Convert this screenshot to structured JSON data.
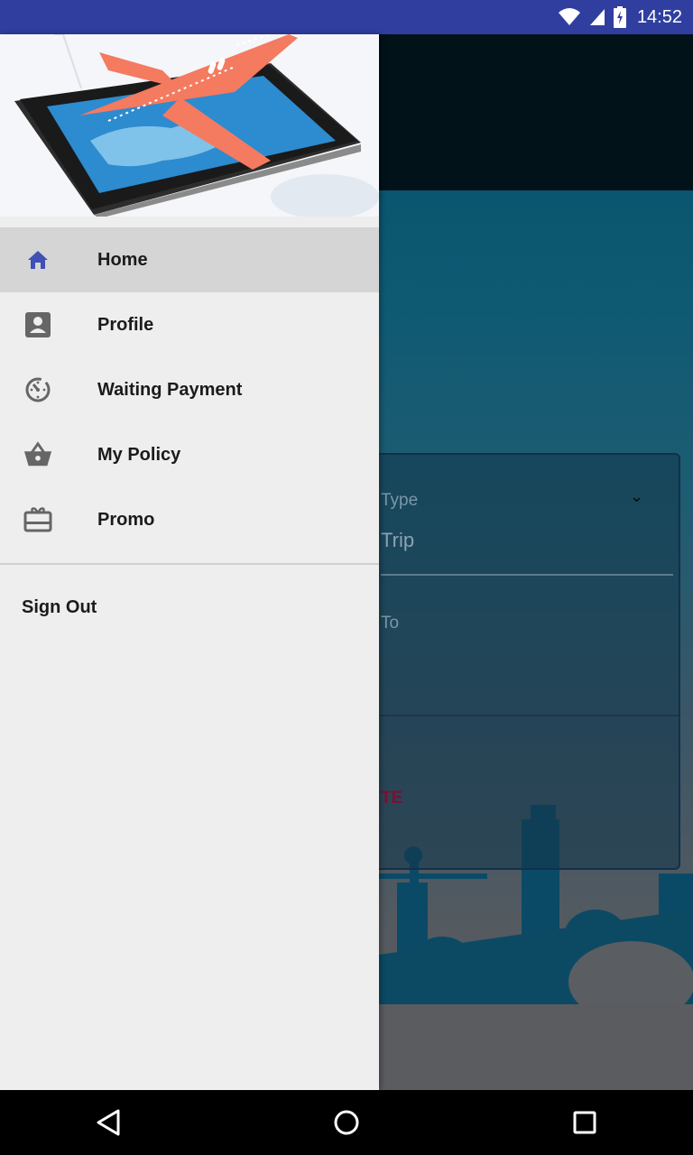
{
  "status_bar": {
    "time": "14:52",
    "icons": [
      "wifi-icon",
      "signal-icon",
      "battery-charging-icon"
    ]
  },
  "background_app": {
    "trip_type_label": "Type",
    "trip_type_value": "Trip",
    "to_label": "To",
    "cta_label": "TE"
  },
  "drawer": {
    "header_image": "tablet-with-airplane-illustration",
    "menu": [
      {
        "label": "Home",
        "icon": "home-icon",
        "active": true
      },
      {
        "label": "Profile",
        "icon": "profile-icon",
        "active": false
      },
      {
        "label": "Waiting Payment",
        "icon": "timer-icon",
        "active": false
      },
      {
        "label": "My Policy",
        "icon": "basket-icon",
        "active": false
      },
      {
        "label": "Promo",
        "icon": "gift-card-icon",
        "active": false
      }
    ],
    "signout_label": "Sign Out"
  },
  "nav_bar": {
    "buttons": [
      "back-icon",
      "home-circle-icon",
      "recents-icon"
    ]
  },
  "colors": {
    "status_bar": "#303f9f",
    "active_icon": "#3f51b5",
    "drawer_bg": "#eeeeee",
    "active_row": "#d5d5d5",
    "plane": "#f47a60"
  }
}
